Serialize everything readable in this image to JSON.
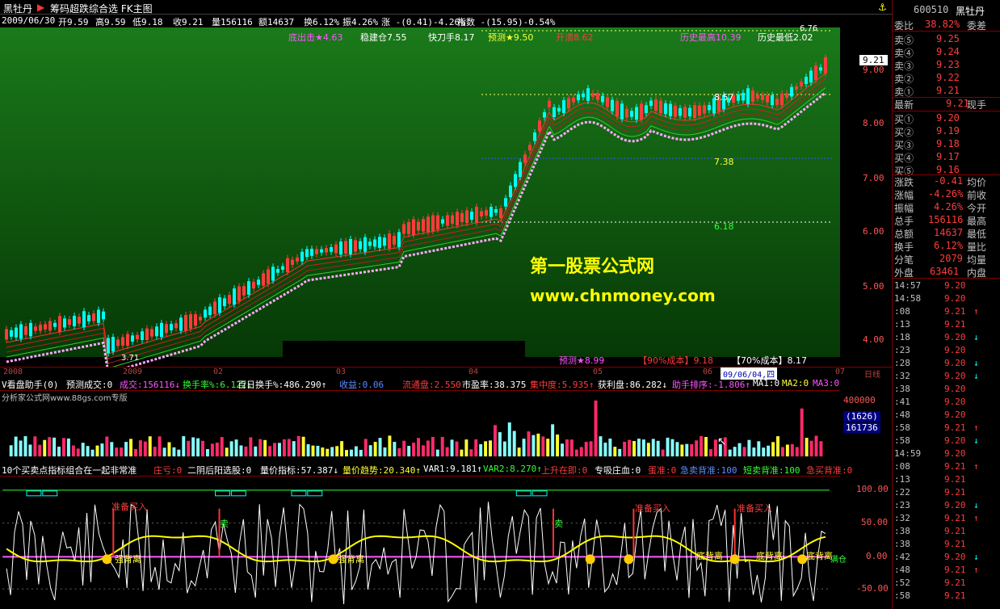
{
  "titlebar": {
    "app_name": "黑牡丹",
    "tab_label": "筹码超跌综合选 FK主图"
  },
  "ohlc": {
    "date": "2009/06/30",
    "open": "开9.59",
    "high": "高9.59",
    "low": "低9.18",
    "close": "收9.21",
    "volume": "量156116",
    "amount": "额14637",
    "turnover": "换6.12%",
    "amplitude": "振4.26%",
    "change": "涨 -(0.41)-4.26%",
    "index": "指数 -(15.95)-0.54%"
  },
  "main_labels": {
    "bottom_hit": "底出击★4.63",
    "stable_position": "稳建仓7.55",
    "fast_blade": "快刀手8.17",
    "predict": "预测★9.50",
    "sell_open": "开溃8.62",
    "hist_high": "历史最高10.39",
    "hist_low": "历史最低2.02",
    "predict_bottom": "预测★8.99",
    "cost90": "【90%成本】9.18",
    "cost70": "【70%成本】8.17",
    "level_857": "8.57",
    "level_738": "7.38",
    "level_618": "6.18",
    "level_676": "6.76",
    "low_marker": "3.71",
    "price_tag": "9.21"
  },
  "price_axis": [
    "9.00",
    "8.00",
    "7.00",
    "6.00",
    "5.00",
    "4.00"
  ],
  "date_axis": [
    "2008",
    "2009",
    "02",
    "03",
    "04",
    "05",
    "06",
    "07"
  ],
  "date_cursor": "09/06/04,四",
  "date_mode": "日线",
  "watermark": {
    "line1": "第一股票公式网",
    "line2": "www.chnmoney.com"
  },
  "volume_info": {
    "title": "V看盘助手(0)",
    "predict_vol": "预测成交:0",
    "vol": "成交:156116↓",
    "turnover_rate": "换手率%:6.122↓",
    "hundred_day": "百日换手%:486.290↑",
    "profit": "收益:0.06",
    "float_shares": "流通盘:2.550",
    "pe": "市盈率:38.375",
    "concentration": "集中度:5.935↑",
    "profit_disk": "获利盘:86.282↓",
    "helper_rank": "助手排序:-1.806↑",
    "ma1": "MA1:0",
    "ma2": "MA2:0",
    "ma3": "MA3:0",
    "source": "分析家公式网www.88gs.com专版"
  },
  "volume_axis": [
    "400000",
    "(1626)",
    "161736"
  ],
  "indicator_info": {
    "title": "10个买卖点指标组合在一起非常准",
    "dealer": "庄亏:0",
    "two_neg": "二阴后阳选股:0",
    "vp_index": "量价指标:57.387↓",
    "vp_trend": "量价趋势:20.340↑",
    "var1": "VAR1:9.181↑",
    "var2": "VAR2:8.270↑",
    "up_coming": "上升在即:0",
    "absorb": "专吸庄血:0",
    "egg": "蛋准:0",
    "rush_sell": "急卖背准:100",
    "short_sell": "短卖背准:100",
    "rush_buy": "急买背准:0"
  },
  "indicator_labels": {
    "ready_buy": "准备买入",
    "sell": "卖",
    "strong_divergence": "强背离",
    "divergence": "底背离",
    "full_position": "满仓"
  },
  "indicator_axis": [
    "100.00",
    "50.00",
    "0.00",
    "-50.00"
  ],
  "quote": {
    "code": "600510",
    "name": "黑牡丹",
    "ratio_label": "委比",
    "ratio_value": "38.82%",
    "diff_label": "委差",
    "sells": [
      {
        "label": "卖⑤",
        "price": "9.25"
      },
      {
        "label": "卖④",
        "price": "9.24"
      },
      {
        "label": "卖③",
        "price": "9.23"
      },
      {
        "label": "卖②",
        "price": "9.22"
      },
      {
        "label": "卖①",
        "price": "9.21"
      }
    ],
    "latest_label": "最新",
    "latest_price": "9.21",
    "latest_right": "现手",
    "buys": [
      {
        "label": "买①",
        "price": "9.20"
      },
      {
        "label": "买②",
        "price": "9.19"
      },
      {
        "label": "买③",
        "price": "9.18"
      },
      {
        "label": "买④",
        "price": "9.17"
      },
      {
        "label": "买⑤",
        "price": "9.16"
      }
    ],
    "stats": [
      {
        "label": "涨跌",
        "value": "-0.41",
        "right": "均价"
      },
      {
        "label": "涨幅",
        "value": "-4.26%",
        "right": "前收"
      },
      {
        "label": "振幅",
        "value": "4.26%",
        "right": "今开"
      },
      {
        "label": "总手",
        "value": "156116",
        "right": "最高"
      },
      {
        "label": "总额",
        "value": "14637",
        "right": "最低"
      },
      {
        "label": "换手",
        "value": "6.12%",
        "right": "量比"
      },
      {
        "label": "分笔",
        "value": "2079",
        "right": "均量"
      }
    ],
    "outer_label": "外盘",
    "outer_value": "63461",
    "inner_label": "内盘"
  },
  "ticks": [
    {
      "time": "14:57",
      "price": "9.20",
      "dir": ""
    },
    {
      "time": "14:58",
      "price": "9.20",
      "dir": ""
    },
    {
      "time": ":08",
      "price": "9.21",
      "dir": "↑"
    },
    {
      "time": ":13",
      "price": "9.21",
      "dir": ""
    },
    {
      "time": ":18",
      "price": "9.20",
      "dir": "↓"
    },
    {
      "time": ":23",
      "price": "9.20",
      "dir": ""
    },
    {
      "time": ":28",
      "price": "9.20",
      "dir": "↓"
    },
    {
      "time": ":32",
      "price": "9.20",
      "dir": "↓"
    },
    {
      "time": ":38",
      "price": "9.20",
      "dir": ""
    },
    {
      "time": ":41",
      "price": "9.20",
      "dir": ""
    },
    {
      "time": ":48",
      "price": "9.20",
      "dir": ""
    },
    {
      "time": ":58",
      "price": "9.21",
      "dir": "↑"
    },
    {
      "time": ":58",
      "price": "9.20",
      "dir": "↓"
    },
    {
      "time": "14:59",
      "price": "9.20",
      "dir": ""
    },
    {
      "time": ":08",
      "price": "9.21",
      "dir": "↑"
    },
    {
      "time": ":13",
      "price": "9.21",
      "dir": ""
    },
    {
      "time": ":22",
      "price": "9.21",
      "dir": ""
    },
    {
      "time": ":23",
      "price": "9.20",
      "dir": "↓"
    },
    {
      "time": ":32",
      "price": "9.21",
      "dir": "↑"
    },
    {
      "time": ":38",
      "price": "9.21",
      "dir": ""
    },
    {
      "time": ":38",
      "price": "9.21",
      "dir": ""
    },
    {
      "time": ":42",
      "price": "9.20",
      "dir": "↓"
    },
    {
      "time": ":48",
      "price": "9.21",
      "dir": "↑"
    },
    {
      "time": ":52",
      "price": "9.21",
      "dir": ""
    },
    {
      "time": ":58",
      "price": "9.21",
      "dir": ""
    }
  ],
  "colors": {
    "up": "#ff3c3c",
    "down": "#00ffff",
    "bg_green": "#0a5a0a",
    "yellow": "#ffff00"
  }
}
